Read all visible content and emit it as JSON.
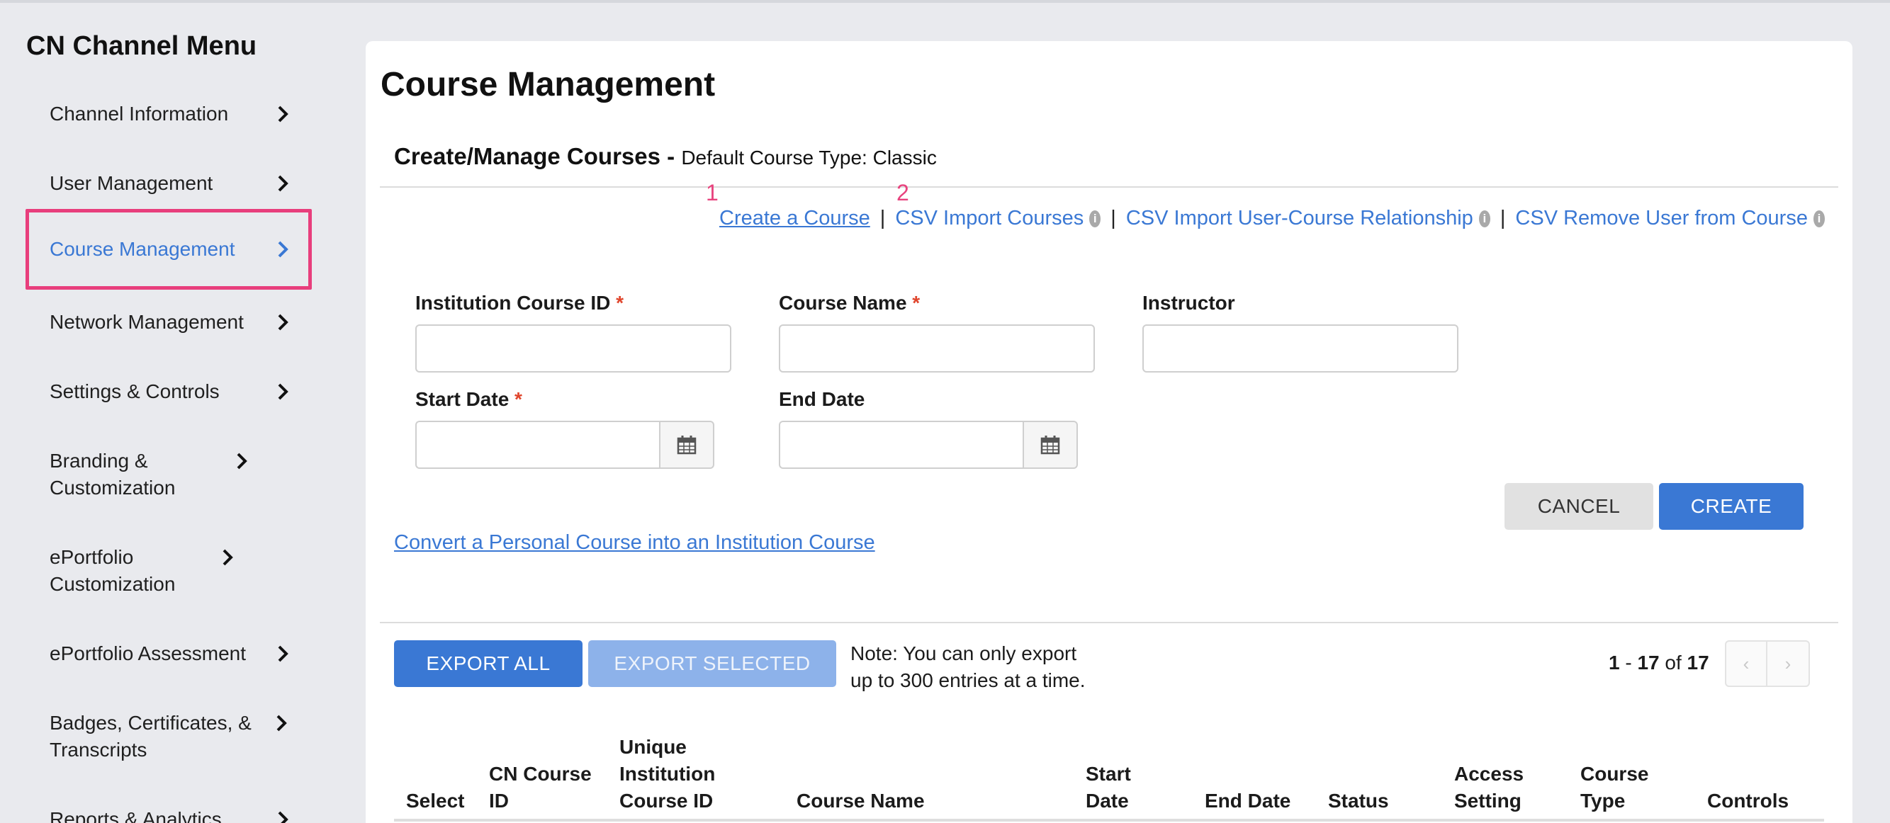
{
  "sidebar": {
    "title": "CN Channel Menu",
    "items": [
      {
        "label": "Channel Information"
      },
      {
        "label": "User Management"
      },
      {
        "label": "Course Management"
      },
      {
        "label": "Network Management"
      },
      {
        "label": "Settings & Controls"
      },
      {
        "label": "Branding & Customization"
      },
      {
        "label": "ePortfolio Customization"
      },
      {
        "label": "ePortfolio Assessment"
      },
      {
        "label": "Badges, Certificates, & Transcripts"
      },
      {
        "label": "Reports & Analytics"
      }
    ],
    "active_index": 2
  },
  "main": {
    "title": "Course Management",
    "section_title": "Create/Manage Courses -",
    "section_subtitle": "Default Course Type: Classic",
    "step_markers": [
      "1",
      "2"
    ],
    "links": {
      "create": "Create a Course",
      "csv_import_courses": "CSV Import Courses",
      "csv_import_relationship": "CSV Import User-Course Relationship",
      "csv_remove_user": "CSV Remove User from Course",
      "separator": "|",
      "info_glyph": "i"
    },
    "form": {
      "institution_course_id_label": "Institution Course ID",
      "course_name_label": "Course Name",
      "instructor_label": "Instructor",
      "start_date_label": "Start Date",
      "end_date_label": "End Date",
      "required_marker": "*",
      "institution_course_id_value": "",
      "course_name_value": "",
      "instructor_value": "",
      "start_date_value": "",
      "end_date_value": ""
    },
    "buttons": {
      "cancel": "CANCEL",
      "create": "CREATE",
      "export_all": "EXPORT ALL",
      "export_selected": "EXPORT SELECTED"
    },
    "convert_link": "Convert a Personal Course into an Institution Course",
    "note_line1": "Note: You can only export",
    "note_line2": "up to 300 entries at a time.",
    "pagination": {
      "start": "1",
      "dash": "-",
      "end": "17",
      "of": "of",
      "total": "17",
      "prev": "‹",
      "next": "›"
    },
    "table": {
      "columns": [
        {
          "line1": "Select"
        },
        {
          "line1": "CN Course",
          "line2": "ID"
        },
        {
          "line1": "Unique",
          "line2": "Institution",
          "line3": "Course ID"
        },
        {
          "line1": "Course Name"
        },
        {
          "line1": "Start",
          "line2": "Date"
        },
        {
          "line1": "End Date"
        },
        {
          "line1": "Status"
        },
        {
          "line1": "Access",
          "line2": "Setting"
        },
        {
          "line1": "Course",
          "line2": "Type"
        },
        {
          "line1": "Controls"
        }
      ]
    }
  },
  "colors": {
    "accent": "#3a78d4",
    "highlight": "#e83e7c",
    "required": "#e0452c"
  }
}
